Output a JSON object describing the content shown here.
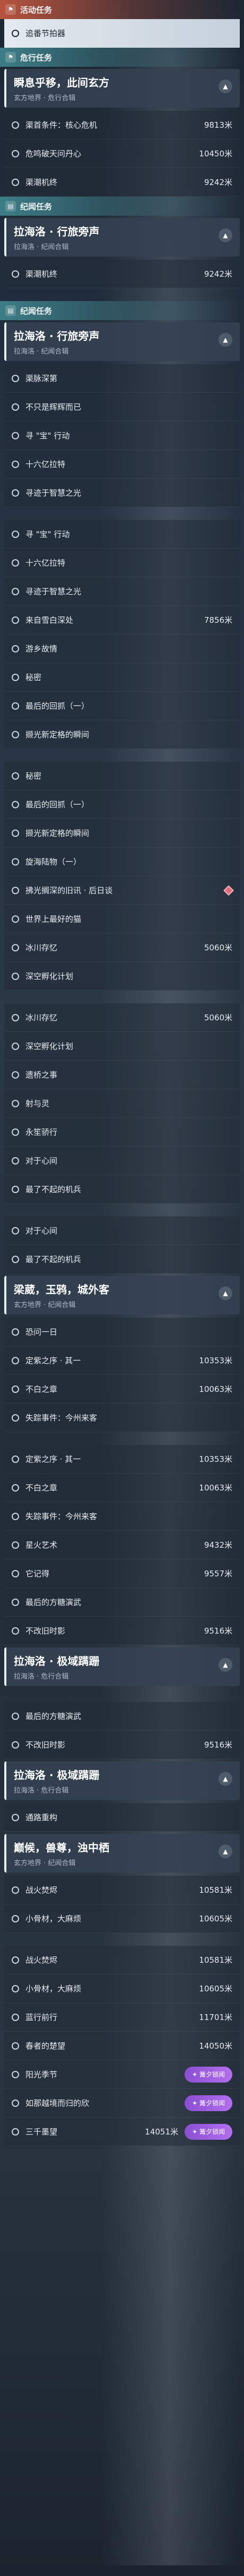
{
  "sections": [
    {
      "type": "header",
      "style": "red",
      "icon": "flag-icon",
      "text": "活动任务"
    },
    {
      "type": "item",
      "label": "追番节拍器",
      "active": true
    },
    {
      "type": "header",
      "style": "teal",
      "icon": "flag-icon",
      "text": "危行任务"
    },
    {
      "type": "card",
      "title": "瞬息乎移，此间玄方",
      "sub": "玄方地界 · 危行合辑"
    },
    {
      "type": "item",
      "label": "渠首条件：核心危机",
      "dist": "9813米"
    },
    {
      "type": "item",
      "label": "危鸣破天问丹心",
      "dist": "10450米"
    },
    {
      "type": "item",
      "label": "渠潮机终",
      "dist": "9242米"
    },
    {
      "type": "header",
      "style": "teal",
      "icon": "book-icon",
      "text": "纪闻任务"
    },
    {
      "type": "card",
      "title": "拉海洛 · 行旅旁声",
      "sub": "拉海洛 · 纪闻合辑"
    },
    {
      "type": "item",
      "label": "渠潮机终",
      "dist": "9242米"
    },
    {
      "type": "gap"
    },
    {
      "type": "header",
      "style": "teal",
      "icon": "book-icon",
      "text": "纪闻任务"
    },
    {
      "type": "card",
      "title": "拉海洛 · 行旅旁声",
      "sub": "拉海洛 · 纪闻合辑"
    },
    {
      "type": "item",
      "label": "渠脉深第"
    },
    {
      "type": "item",
      "label": "不只是辉辉而已"
    },
    {
      "type": "item",
      "label": "寻 \"宝\" 行动"
    },
    {
      "type": "item",
      "label": "十六亿拉特"
    },
    {
      "type": "item",
      "label": "寻迹于智慧之光"
    },
    {
      "type": "gap"
    },
    {
      "type": "item",
      "label": "寻 \"宝\" 行动"
    },
    {
      "type": "item",
      "label": "十六亿拉特"
    },
    {
      "type": "item",
      "label": "寻迹于智慧之光"
    },
    {
      "type": "item",
      "label": "来自雪白深处",
      "dist": "7856米"
    },
    {
      "type": "item",
      "label": "游乡故情"
    },
    {
      "type": "item",
      "label": "秘密"
    },
    {
      "type": "item",
      "label": "最后的回抓（一）"
    },
    {
      "type": "item",
      "label": "撷光新定格的瞬间"
    },
    {
      "type": "gap"
    },
    {
      "type": "item",
      "label": "秘密"
    },
    {
      "type": "item",
      "label": "最后的回抓（一）"
    },
    {
      "type": "item",
      "label": "撷光新定格的瞬间"
    },
    {
      "type": "item",
      "label": "旋海陆物（一）"
    },
    {
      "type": "item",
      "label": "拂光搁深的旧讯 · 后日谈",
      "diamond": true
    },
    {
      "type": "item",
      "label": "世界上最好的猫"
    },
    {
      "type": "item",
      "label": "冰川存忆",
      "dist": "5060米"
    },
    {
      "type": "item",
      "label": "深空孵化计划"
    },
    {
      "type": "gap"
    },
    {
      "type": "item",
      "label": "冰川存忆",
      "dist": "5060米"
    },
    {
      "type": "item",
      "label": "深空孵化计划"
    },
    {
      "type": "item",
      "label": "遗桥之事"
    },
    {
      "type": "item",
      "label": "射与灵"
    },
    {
      "type": "item",
      "label": "永笙骄行"
    },
    {
      "type": "item",
      "label": "对于心间"
    },
    {
      "type": "item",
      "label": "最了不起的机兵"
    },
    {
      "type": "gap"
    },
    {
      "type": "item",
      "label": "对于心间"
    },
    {
      "type": "item",
      "label": "最了不起的机兵"
    },
    {
      "type": "card",
      "title": "梁葳，玉鸦，城外客",
      "sub": "玄方地界 · 纪闻合辑"
    },
    {
      "type": "item",
      "label": "恐问一日"
    },
    {
      "type": "item",
      "label": "定紫之序 · 其一",
      "dist": "10353米"
    },
    {
      "type": "item",
      "label": "不白之章",
      "dist": "10063米"
    },
    {
      "type": "item",
      "label": "失踪事件：今州来客"
    },
    {
      "type": "gap"
    },
    {
      "type": "item",
      "label": "定紫之序 · 其一",
      "dist": "10353米"
    },
    {
      "type": "item",
      "label": "不白之章",
      "dist": "10063米"
    },
    {
      "type": "item",
      "label": "失踪事件：今州来客"
    },
    {
      "type": "item",
      "label": "星火艺术",
      "dist": "9432米"
    },
    {
      "type": "item",
      "label": "它记得",
      "dist": "9557米"
    },
    {
      "type": "item",
      "label": "最后的方糖演武"
    },
    {
      "type": "item",
      "label": "不改旧时影",
      "dist": "9516米"
    },
    {
      "type": "card",
      "title": "拉海洛 · 极域蹒跚",
      "sub": "拉海洛 · 危行合辑"
    },
    {
      "type": "gap"
    },
    {
      "type": "item",
      "label": "最后的方糖演武"
    },
    {
      "type": "item",
      "label": "不改旧时影",
      "dist": "9516米"
    },
    {
      "type": "card",
      "title": "拉海洛 · 极域蹒跚",
      "sub": "拉海洛 · 危行合辑"
    },
    {
      "type": "item",
      "label": "通路重构"
    },
    {
      "type": "card",
      "title": "巅候，兽尊，浊中栖",
      "sub": "玄方地界 · 纪闻合辑"
    },
    {
      "type": "item",
      "label": "战火焚烬",
      "dist": "10581米"
    },
    {
      "type": "item",
      "label": "小骨材，大麻烦",
      "dist": "10605米"
    },
    {
      "type": "gap"
    },
    {
      "type": "item",
      "label": "战火焚烬",
      "dist": "10581米"
    },
    {
      "type": "item",
      "label": "小骨材，大麻烦",
      "dist": "10605米"
    },
    {
      "type": "item",
      "label": "蓝行前行",
      "dist": "11701米"
    },
    {
      "type": "item",
      "label": "春者的楚望",
      "dist": "14050米"
    },
    {
      "type": "item",
      "label": "阳光季节",
      "badge": "篝夕锁闻"
    },
    {
      "type": "item",
      "label": "如那越境而归的欣",
      "badge": "篝夕锁闻"
    },
    {
      "type": "item",
      "label": "三千墨望",
      "dist": "14051米",
      "badge": "篝夕锁闻"
    }
  ]
}
